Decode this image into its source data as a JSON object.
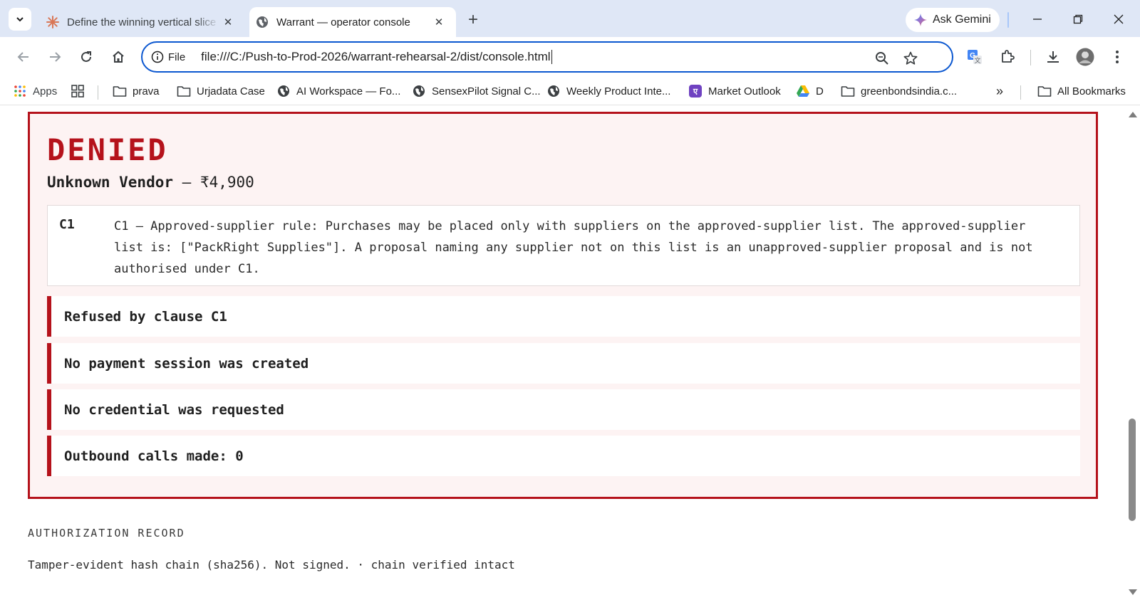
{
  "browser": {
    "tabs": [
      {
        "title": "Define the winning vertical slice",
        "icon": "claude-spark-icon",
        "active": false
      },
      {
        "title": "Warrant — operator console",
        "icon": "globe-icon",
        "active": true
      }
    ],
    "gemini_label": "Ask Gemini",
    "omnibox": {
      "scheme_label": "File",
      "url": "file:///C:/Push-to-Prod-2026/warrant-rehearsal-2/dist/console.html"
    },
    "bookmarks": [
      {
        "label": "Apps",
        "icon": "apps-grid-icon"
      },
      {
        "label": "prava",
        "icon": "folder-icon"
      },
      {
        "label": "Urjadata Case",
        "icon": "folder-icon"
      },
      {
        "label": "AI Workspace — Fo...",
        "icon": "globe-icon"
      },
      {
        "label": "SensexPilot Signal C...",
        "icon": "globe-icon"
      },
      {
        "label": "Weekly Product Inte...",
        "icon": "globe-icon"
      },
      {
        "label": "Market Outlook",
        "icon": "app-icon"
      },
      {
        "label": "D",
        "icon": "drive-icon"
      },
      {
        "label": "greenbondsindia.c...",
        "icon": "folder-icon"
      }
    ],
    "overflow_label": "»",
    "all_bookmarks_label": "All Bookmarks"
  },
  "colors": {
    "denied_accent": "#b5121b",
    "card_background": "#fdf3f3",
    "omnibox_focus": "#0b57d0"
  },
  "decision": {
    "verdict": "DENIED",
    "vendor": "Unknown Vendor",
    "separator": " — ",
    "amount": "₹4,900",
    "clause": {
      "id": "C1",
      "text": "C1 — Approved-supplier rule: Purchases may be placed only with suppliers on the approved-supplier list. The approved-supplier list is: [\"PackRight Supplies\"]. A proposal naming any supplier not on this list is an unapproved-supplier proposal and is not authorised under C1."
    },
    "evidence": [
      "Refused by clause C1",
      "No payment session was created",
      "No credential was requested",
      "Outbound calls made: 0"
    ]
  },
  "authorization_record": {
    "heading": "AUTHORIZATION RECORD",
    "summary": "Tamper-evident hash chain (sha256). Not signed. · chain verified intact"
  }
}
